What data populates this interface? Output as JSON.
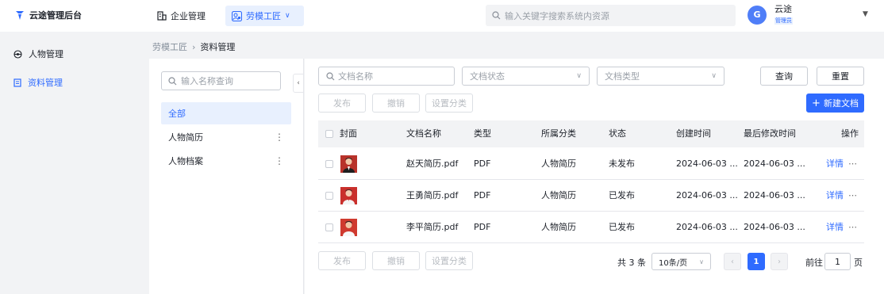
{
  "app": {
    "title": "云途管理后台"
  },
  "nav": {
    "items": [
      {
        "label": "企业管理",
        "icon": "building-icon"
      },
      {
        "label": "劳模工匠",
        "icon": "worker-icon",
        "active": true
      }
    ]
  },
  "search": {
    "placeholder": "输入关键字搜索系统内资源"
  },
  "user": {
    "avatar_letter": "G",
    "name": "云途",
    "role": "管理员"
  },
  "sidebar": {
    "items": [
      {
        "label": "人物管理",
        "icon": "target-icon"
      },
      {
        "label": "资料管理",
        "icon": "document-icon",
        "active": true
      }
    ]
  },
  "breadcrumb": {
    "parent": "劳模工匠",
    "current": "资料管理"
  },
  "category": {
    "search_placeholder": "输入名称查询",
    "items": [
      {
        "label": "全部",
        "active": true
      },
      {
        "label": "人物简历"
      },
      {
        "label": "人物档案"
      }
    ]
  },
  "filters": {
    "name_placeholder": "文档名称",
    "status_placeholder": "文档状态",
    "type_placeholder": "文档类型",
    "query_label": "查询",
    "reset_label": "重置"
  },
  "actions": {
    "publish_label": "发布",
    "revoke_label": "撤销",
    "set_category_label": "设置分类",
    "new_label": "新建文档"
  },
  "table": {
    "headers": [
      "封面",
      "文档名称",
      "类型",
      "所属分类",
      "状态",
      "创建时间",
      "最后修改时间",
      "操作"
    ],
    "rows": [
      {
        "name": "赵天简历.pdf",
        "type": "PDF",
        "category": "人物简历",
        "status": "未发布",
        "created": "2024-06-03 ...",
        "modified": "2024-06-03 ...",
        "action": "详情"
      },
      {
        "name": "王勇简历.pdf",
        "type": "PDF",
        "category": "人物简历",
        "status": "已发布",
        "created": "2024-06-03 ...",
        "modified": "2024-06-03 ...",
        "action": "详情"
      },
      {
        "name": "李平简历.pdf",
        "type": "PDF",
        "category": "人物简历",
        "status": "已发布",
        "created": "2024-06-03 ...",
        "modified": "2024-06-03 ...",
        "action": "详情"
      }
    ]
  },
  "pagination": {
    "total": "共 3 条",
    "page_size": "10条/页",
    "current": "1",
    "jump_prefix": "前往",
    "jump_value": "1",
    "jump_suffix": "页"
  },
  "colors": {
    "accent": "#2f6bff",
    "accent_light": "#e8f0fe",
    "cover_red": "#c0392b"
  }
}
